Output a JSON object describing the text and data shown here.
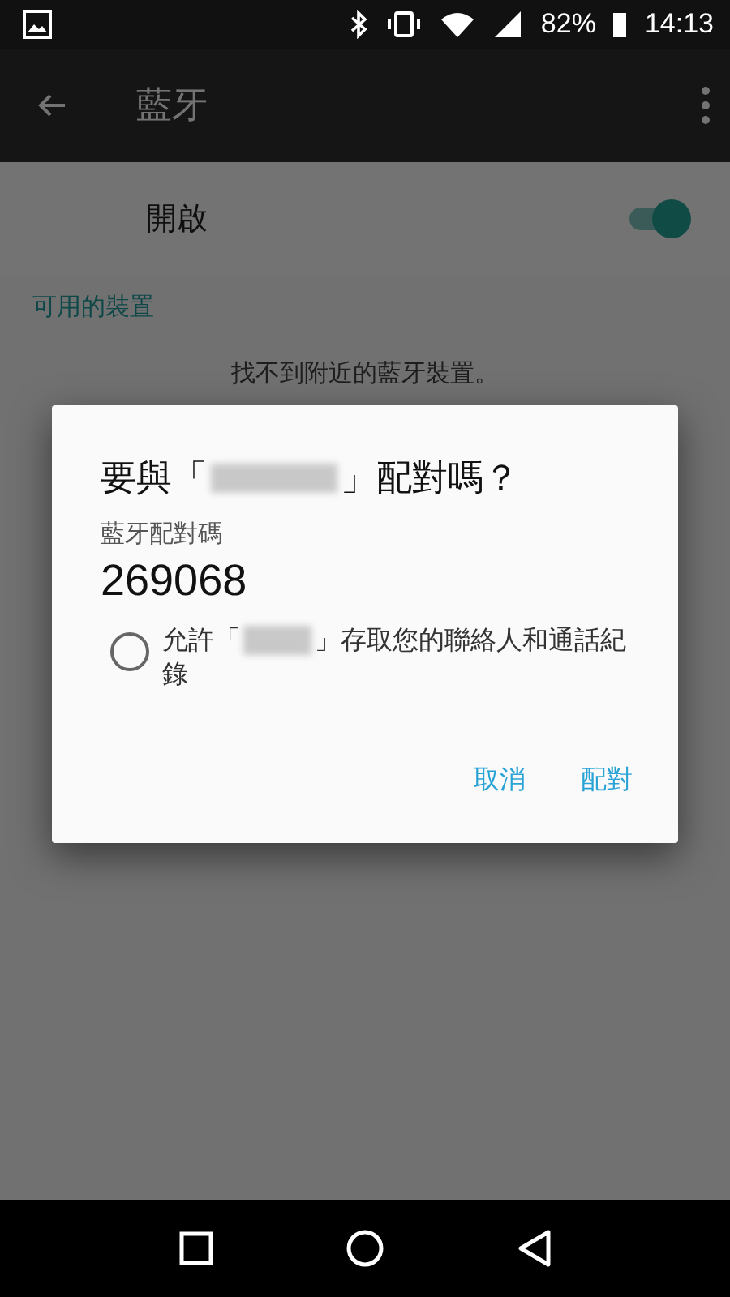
{
  "status_bar": {
    "battery": "82%",
    "time": "14:13"
  },
  "toolbar": {
    "title": "藍牙"
  },
  "switch_row": {
    "label": "開啟",
    "on": true
  },
  "section_header": "可用的裝置",
  "empty_message": "找不到附近的藍牙裝置。",
  "dialog": {
    "title_prefix": "要與「",
    "title_suffix": "」配對嗎？",
    "code_label": "藍牙配對碼",
    "code": "269068",
    "option": {
      "prefix": "允許「",
      "suffix": "」存取您的聯絡人和通話紀",
      "continuation": "錄",
      "checked": false
    },
    "buttons": [
      "取消",
      "配對"
    ]
  }
}
